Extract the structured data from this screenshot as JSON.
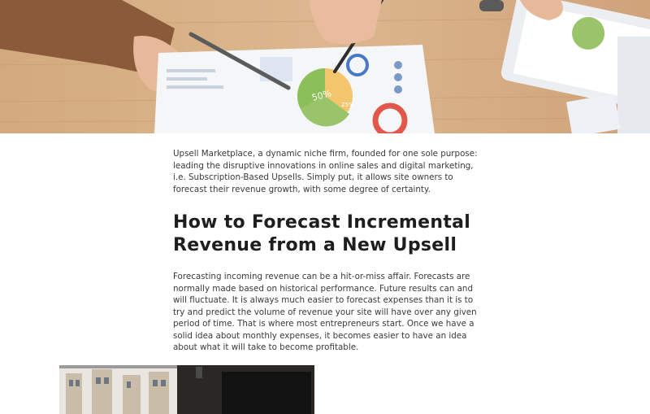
{
  "hero_image": {
    "icon": "business-charts-photo",
    "chart_label": "50%",
    "chart_label_small": "25%"
  },
  "article": {
    "intro": "Upsell Marketplace, a dynamic niche firm, founded for one sole purpose: leading the disruptive innovations in online sales and digital marketing, i.e. Subscription-Based Upsells. Simply put, it allows site owners to forecast their revenue growth, with some degree of certainty.",
    "heading": "How to Forecast Incremental Revenue from a New Upsell",
    "body": "Forecasting incoming revenue can be a hit-or-miss affair. Forecasts are normally made based on historical performance. Future results can and will fluctuate. It is always much easier to forecast expenses than it is to try and predict the volume of revenue your site will have over any given period of time. That is where most entrepreneurs start. Once we have a solid idea about monthly expenses, it becomes easier to have an idea about what it will take to become profitable."
  },
  "gallery": {
    "icon": "office-building-photo"
  }
}
